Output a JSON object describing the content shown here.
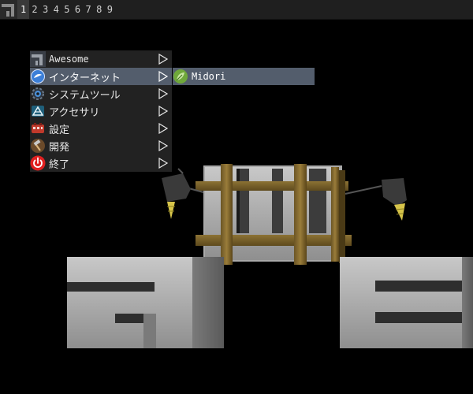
{
  "wibar": {
    "launcher_icon": "awesome-logo-icon",
    "tags": [
      "1",
      "2",
      "3",
      "4",
      "5",
      "6",
      "7",
      "8",
      "9"
    ],
    "active_tag": "1"
  },
  "menu": {
    "items": [
      {
        "label": "Awesome",
        "icon": "awesome-logo-icon"
      },
      {
        "label": "インターネット",
        "icon": "globe-icon"
      },
      {
        "label": "システムツール",
        "icon": "gear-icon"
      },
      {
        "label": "アクセサリ",
        "icon": "accessories-icon"
      },
      {
        "label": "設定",
        "icon": "settings-icon"
      },
      {
        "label": "開発",
        "icon": "hammer-icon"
      },
      {
        "label": "終了",
        "icon": "power-icon"
      }
    ],
    "selected_index": 1
  },
  "submenu": {
    "items": [
      {
        "label": "Midori",
        "icon": "midori-leaf-icon"
      }
    ]
  },
  "colors": {
    "bar_bg": "#1f1f1f",
    "menu_bg": "#222222",
    "menu_selected": "#535d6c",
    "wallpaper_bg": "#000000"
  }
}
